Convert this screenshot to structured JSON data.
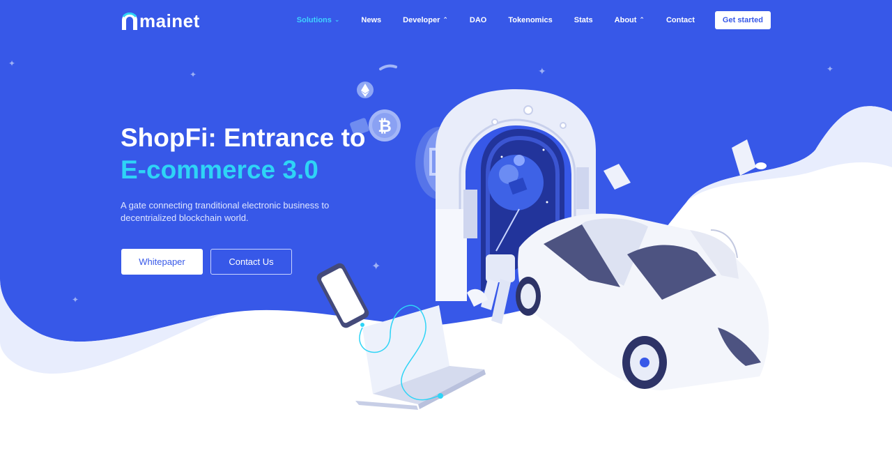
{
  "brand": {
    "name": "mainet"
  },
  "nav": {
    "items": [
      {
        "label": "Solutions",
        "active": true,
        "dropdown": "down"
      },
      {
        "label": "News"
      },
      {
        "label": "Developer",
        "dropdown": "up"
      },
      {
        "label": "DAO"
      },
      {
        "label": "Tokenomics"
      },
      {
        "label": "Stats"
      },
      {
        "label": "About",
        "dropdown": "up"
      },
      {
        "label": "Contact"
      }
    ],
    "cta_label": "Get started"
  },
  "hero": {
    "title_line1": "ShopFi: Entrance to",
    "title_line2": "E-commerce 3.0",
    "description": "A gate connecting tranditional electronic business to decentrialized blockchain world.",
    "primary_button": "Whitepaper",
    "secondary_button": "Contact Us"
  },
  "colors": {
    "hero_blue": "#3758e8",
    "accent_cyan": "#2ed4f6",
    "nav_active": "#3fd3ff"
  },
  "icons": [
    "bitcoin-coin-icon",
    "ethereum-coin-icon",
    "binance-coin-icon",
    "sparkle-icon",
    "chevron-down-icon",
    "chevron-up-icon"
  ]
}
